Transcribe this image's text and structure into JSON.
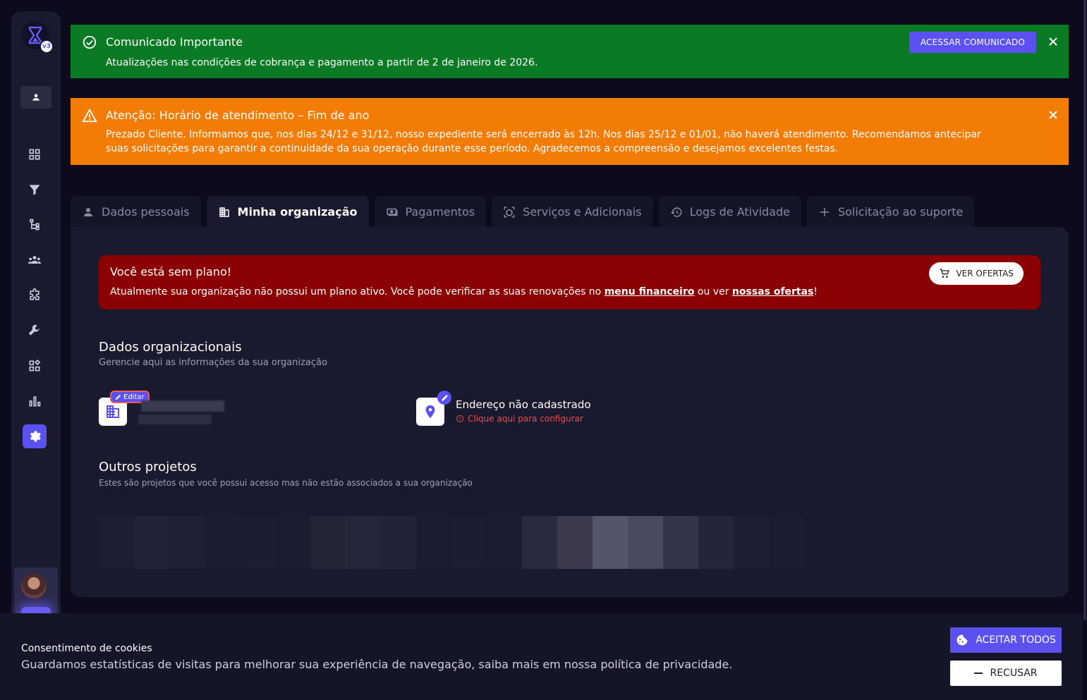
{
  "colors": {
    "accent": "#5b50f0",
    "success_banner": "#0a7a24",
    "warning_banner": "#f27c05",
    "error_alert": "#8b0000",
    "background": "#0b0b1c",
    "card": "#1a1a2e"
  },
  "sidebar": {
    "logo_badge": "v3",
    "items": [
      {
        "icon": "dashboard-icon"
      },
      {
        "icon": "filter-icon"
      },
      {
        "icon": "hierarchy-icon"
      },
      {
        "icon": "team-icon"
      },
      {
        "icon": "puzzle-icon"
      },
      {
        "icon": "wrench-icon"
      },
      {
        "icon": "widgets-icon"
      },
      {
        "icon": "bar-chart-icon"
      },
      {
        "icon": "gear-icon",
        "active": true
      }
    ]
  },
  "banners": {
    "green": {
      "title": "Comunicado Importante",
      "text": "Atualizações nas condições de cobrança e pagamento a partir de 2 de janeiro de 2026.",
      "button": "ACESSAR COMUNICADO"
    },
    "orange": {
      "title": "Atenção: Horário de atendimento – Fim de ano",
      "text": "Prezado Cliente, Informamos que, nos dias 24/12 e 31/12, nosso expediente será encerrado às 12h. Nos dias 25/12 e 01/01, não haverá atendimento. Recomendamos antecipar suas solicitações para garantir a continuidade da sua operação durante esse período. Agradecemos a compreensão e desejamos excelentes festas."
    }
  },
  "tabs": [
    {
      "label": "Dados pessoais",
      "icon": "person-icon"
    },
    {
      "label": "Minha organização",
      "icon": "building-icon",
      "active": true
    },
    {
      "label": "Pagamentos",
      "icon": "payments-icon"
    },
    {
      "label": "Serviços e Adicionais",
      "icon": "services-icon"
    },
    {
      "label": "Logs de Atividade",
      "icon": "history-icon"
    },
    {
      "label": "Solicitação ao suporte",
      "icon": "plus-icon"
    }
  ],
  "plan_alert": {
    "title": "Você está sem plano!",
    "text_before": "Atualmente sua organização não possui um plano ativo. Você pode verificar as suas renovações no ",
    "link1": "menu financeiro",
    "text_middle": " ou ver ",
    "link2": "nossas ofertas",
    "text_after": "!",
    "button": "VER OFERTAS"
  },
  "org_data": {
    "title": "Dados organizacionais",
    "subtitle": "Gerencie aqui as informações da sua organização",
    "edit_label": "Editar",
    "address_title": "Endereço não cadastrado",
    "address_link": "Clique aqui para configurar"
  },
  "other_projects": {
    "title": "Outros projetos",
    "subtitle": "Estes são projetos que você possui acesso mas não estão associados a sua organização"
  },
  "cookies": {
    "title": "Consentimento de cookies",
    "text": "Guardamos estatísticas de visitas para melhorar sua experiência de navegação, saiba mais em nossa política de privacidade.",
    "accept": "ACEITAR TODOS",
    "refuse": "RECUSAR"
  }
}
